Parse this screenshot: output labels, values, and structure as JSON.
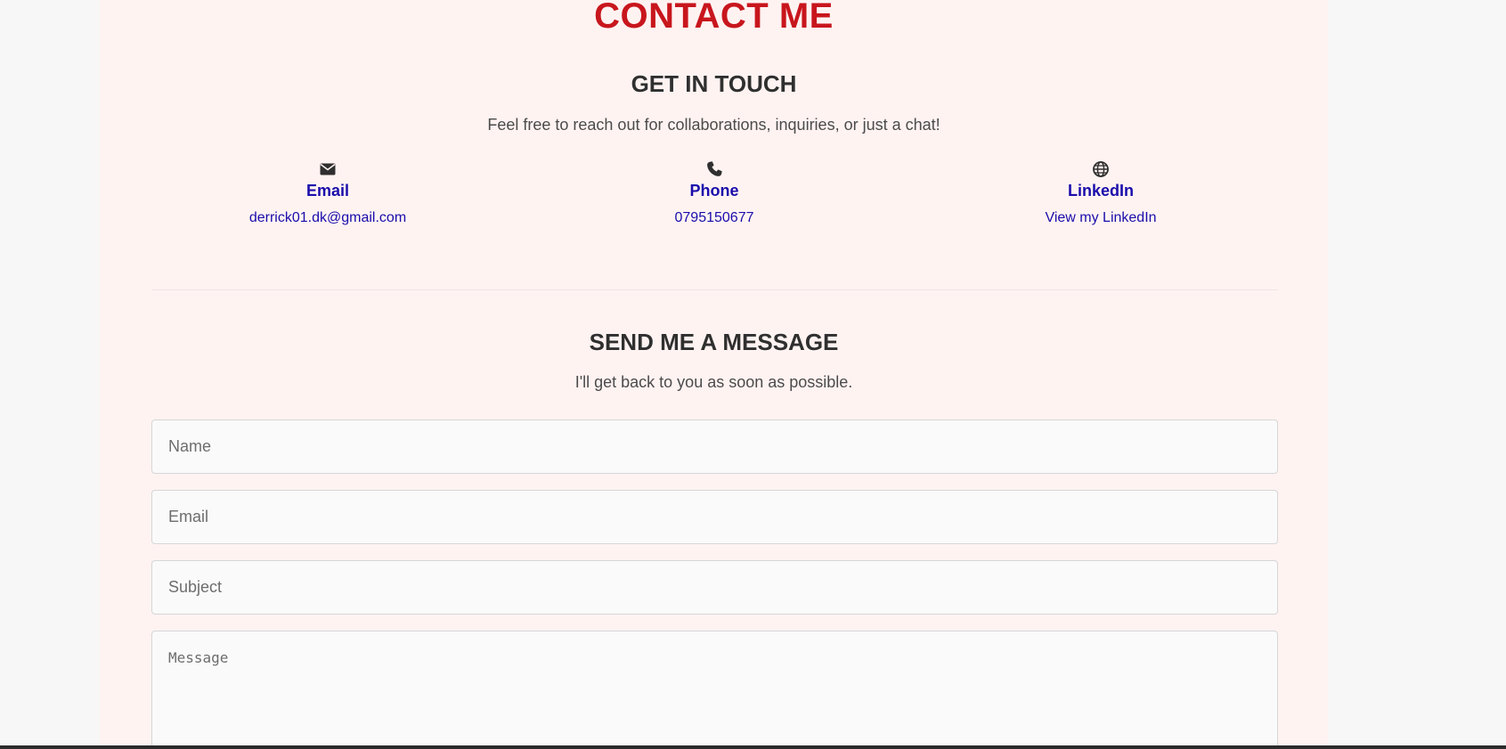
{
  "header": {
    "title": "CONTACT ME"
  },
  "get_in_touch": {
    "heading": "GET IN TOUCH",
    "description": "Feel free to reach out for collaborations, inquiries, or just a chat!",
    "items": [
      {
        "icon": "envelope-icon",
        "label": "Email",
        "value": "derrick01.dk@gmail.com"
      },
      {
        "icon": "phone-icon",
        "label": "Phone",
        "value": "0795150677"
      },
      {
        "icon": "globe-icon",
        "label": "LinkedIn",
        "value": "View my LinkedIn"
      }
    ]
  },
  "message_form": {
    "heading": "SEND ME A MESSAGE",
    "description": "I'll get back to you as soon as possible.",
    "name_placeholder": "Name",
    "email_placeholder": "Email",
    "subject_placeholder": "Subject",
    "message_placeholder": "Message"
  },
  "colors": {
    "title_red": "#c8161d",
    "link_blue": "#1a0dab",
    "panel_background": "#fff3f2"
  }
}
